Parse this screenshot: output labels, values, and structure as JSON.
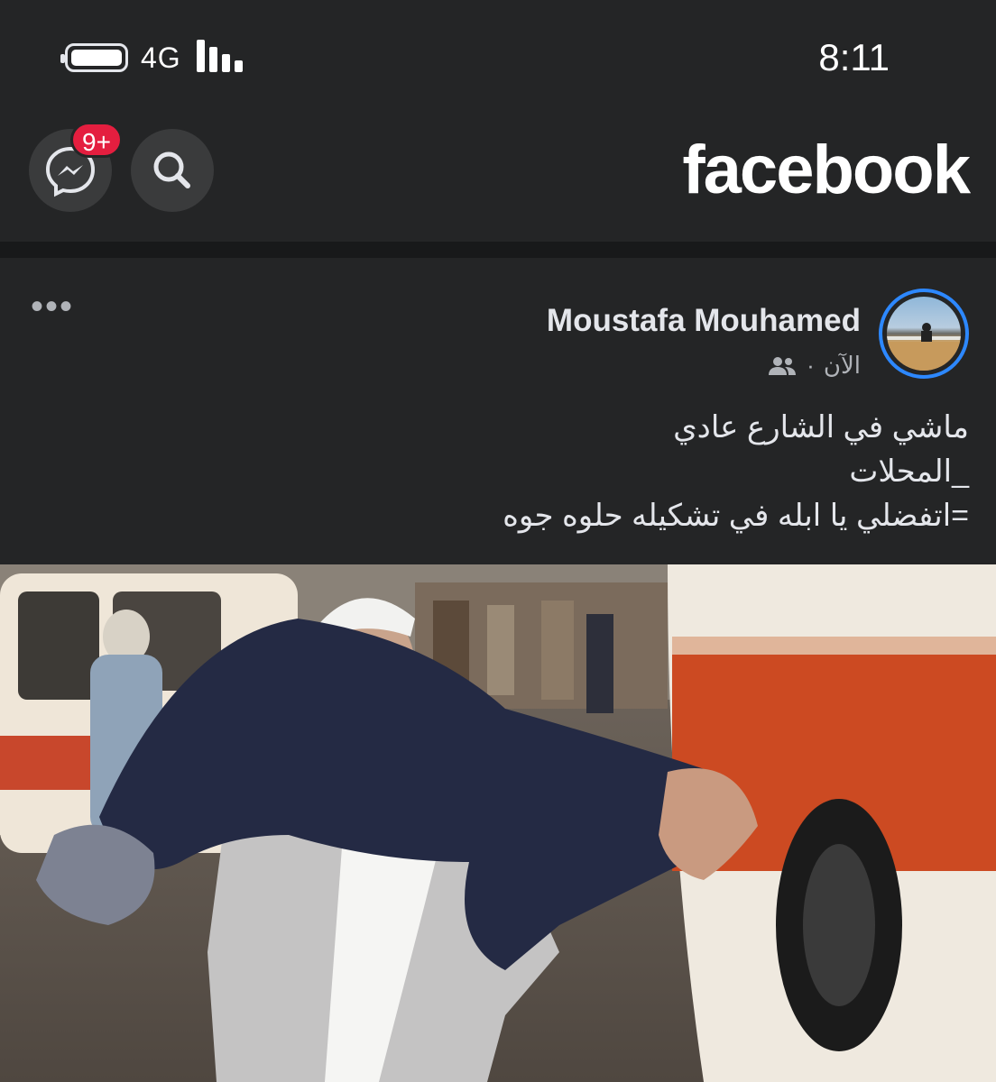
{
  "status_bar": {
    "network": "4G",
    "time": "8:11"
  },
  "header": {
    "logo": "facebook",
    "messenger_badge": "9+",
    "icons": [
      "messenger-icon",
      "search-icon"
    ]
  },
  "post": {
    "author": "Moustafa Mouhamed",
    "timestamp": "الآن",
    "audience_icon": "friends-icon",
    "text_lines": [
      "ماشي في الشارع عادي",
      "_المحلات",
      "=اتفضلي يا ابله في تشكيله حلوه جوه"
    ]
  },
  "colors": {
    "background": "#242526",
    "separator": "#18191a",
    "badge": "#e41e3f",
    "avatar_ring": "#2d88ff",
    "text": "#e4e6eb",
    "secondary_text": "#b0b3b8"
  }
}
